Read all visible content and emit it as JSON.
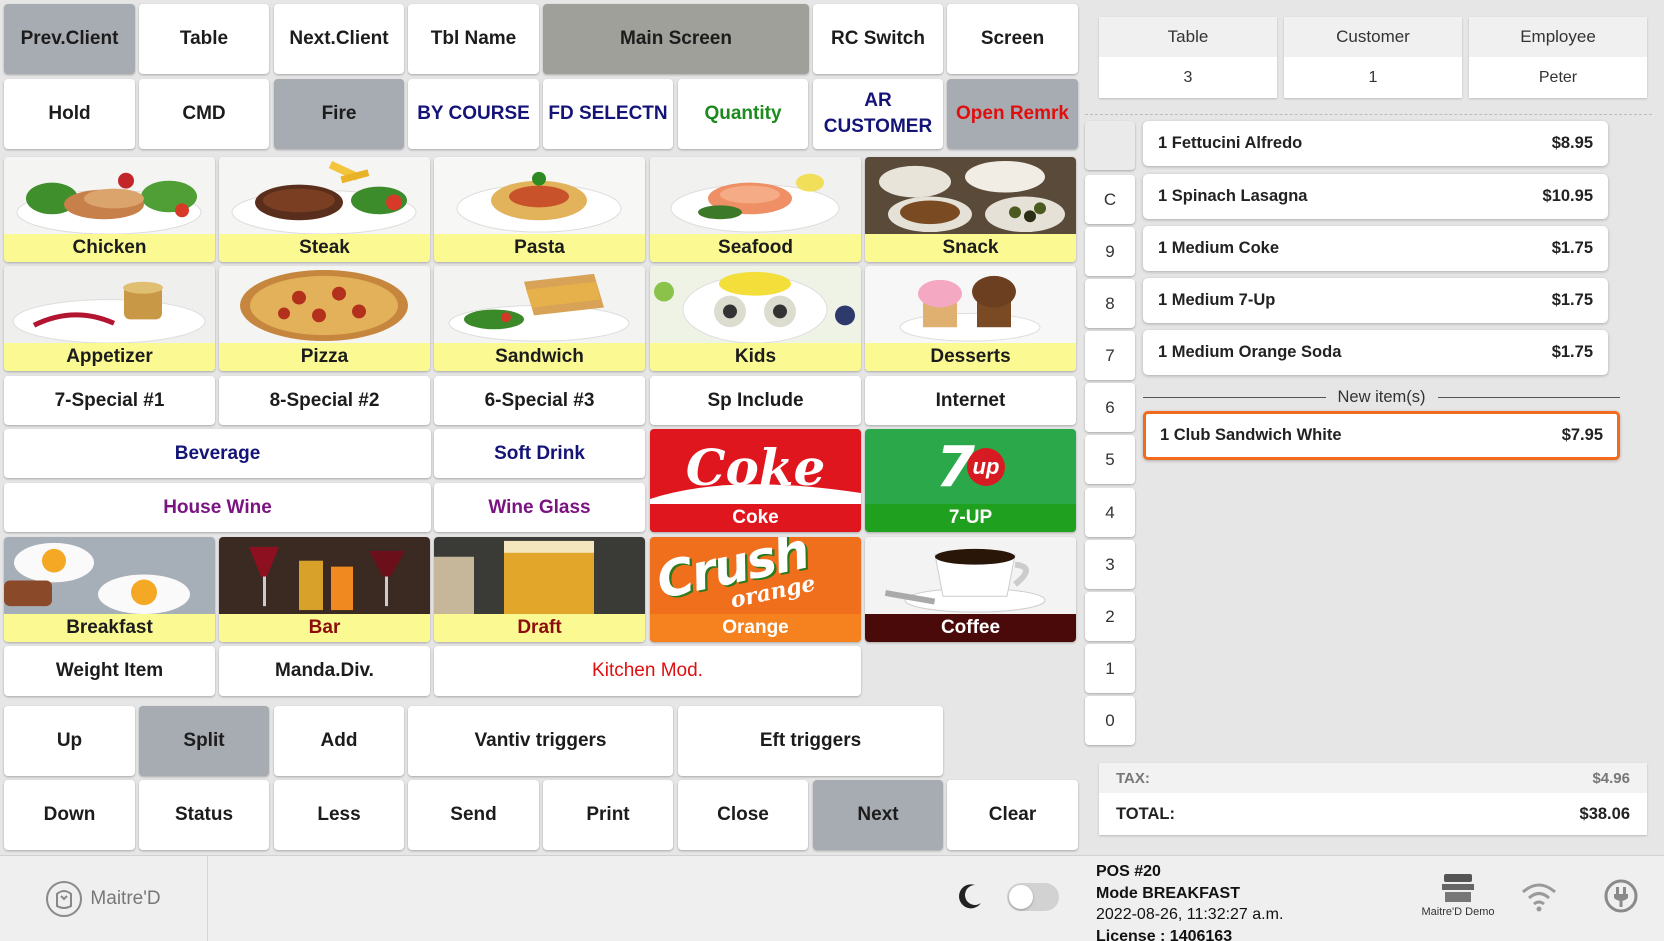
{
  "top_buttons": {
    "prev_client": "Prev.Client",
    "table": "Table",
    "next_client": "Next.Client",
    "tbl_name": "Tbl Name",
    "main_screen": "Main Screen",
    "rc_switch": "RC Switch",
    "screen": "Screen",
    "hold": "Hold",
    "cmd": "CMD",
    "fire": "Fire",
    "by_course": "BY COURSE",
    "fd_selectn": "FD SELECTN",
    "quantity": "Quantity",
    "ar_customer_1": "AR",
    "ar_customer_2": "CUSTOMER",
    "open_remrk": "Open Remrk"
  },
  "categories": {
    "chicken": "Chicken",
    "steak": "Steak",
    "pasta": "Pasta",
    "seafood": "Seafood",
    "snack": "Snack",
    "appetizer": "Appetizer",
    "pizza": "Pizza",
    "sandwich": "Sandwich",
    "kids": "Kids",
    "desserts": "Desserts",
    "breakfast": "Breakfast",
    "bar": "Bar",
    "draft": "Draft",
    "orange": "Orange",
    "coffee": "Coffee",
    "coke": "Coke",
    "seven_up": "7-UP"
  },
  "logos": {
    "coke": "Coke",
    "seven_up_num": "7",
    "seven_up_word": "up",
    "crush": "Crush",
    "orange_word": "orange"
  },
  "menu_buttons": {
    "special1": "7-Special #1",
    "special2": "8-Special #2",
    "special3": "6-Special #3",
    "sp_include": "Sp Include",
    "internet": "Internet",
    "beverage": "Beverage",
    "soft_drink": "Soft Drink",
    "house_wine": "House Wine",
    "wine_glass": "Wine Glass",
    "weight_item": "Weight Item",
    "manda_div": "Manda.Div.",
    "kitchen_mod": "Kitchen Mod."
  },
  "bottom_buttons": {
    "up": "Up",
    "split": "Split",
    "add": "Add",
    "vantiv": "Vantiv triggers",
    "eft": "Eft triggers",
    "down": "Down",
    "status": "Status",
    "less": "Less",
    "send": "Send",
    "print": "Print",
    "close": "Close",
    "next": "Next",
    "clear": "Clear"
  },
  "header": {
    "table_label": "Table",
    "table_value": "3",
    "customer_label": "Customer",
    "customer_value": "1",
    "employee_label": "Employee",
    "employee_value": "Peter"
  },
  "numpad": [
    "",
    "C",
    "9",
    "8",
    "7",
    "6",
    "5",
    "4",
    "3",
    "2",
    "1",
    "0"
  ],
  "order": {
    "items": [
      {
        "name": "1 Fettucini Alfredo",
        "price": "$8.95"
      },
      {
        "name": "1 Spinach Lasagna",
        "price": "$10.95"
      },
      {
        "name": "1 Medium Coke",
        "price": "$1.75"
      },
      {
        "name": "1 Medium 7-Up",
        "price": "$1.75"
      },
      {
        "name": "1 Medium Orange Soda",
        "price": "$1.75"
      }
    ],
    "new_items_label": "New item(s)",
    "new_items": [
      {
        "name": "1 Club Sandwich White",
        "price": "$7.95"
      }
    ],
    "tax_label": "TAX:",
    "tax_value": "$4.96",
    "total_label": "TOTAL:",
    "total_value": "$38.06"
  },
  "footer": {
    "logo_text": "Maitre'D",
    "pos": "POS #20",
    "mode": "Mode BREAKFAST",
    "datetime": "2022-08-26, 11:32:27 a.m.",
    "license": "License : 1406163",
    "demo_label": "Maitre'D Demo",
    "dark_mode_on": false
  },
  "colors": {
    "accent_orange": "#f26b1d",
    "category_label_bg": "#fbfa92",
    "selected_gray": "#a7abb2",
    "navy_text": "#141478",
    "purple_text": "#7a1481",
    "red_text": "#e10e0e",
    "green_text": "#1d8a1d"
  },
  "icons": {
    "dark_mode": "moon-icon",
    "wifi": "wifi-icon",
    "power": "power-plug-icon",
    "demo": "demo-store-icon",
    "logo": "maitred-logo-icon"
  }
}
